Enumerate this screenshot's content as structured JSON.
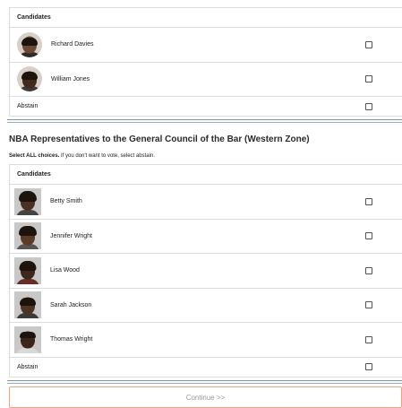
{
  "section1": {
    "header": "Candidates",
    "candidates": [
      {
        "name": "Richard Davies"
      },
      {
        "name": "William Jones"
      }
    ],
    "abstain_label": "Abstain"
  },
  "section2": {
    "title": "NBA Representatives to the General Council of the Bar (Western Zone)",
    "instruction_bold": "Select ALL choices.",
    "instruction_rest": " If you don't want to vote, select abstain.",
    "header": "Candidates",
    "candidates": [
      {
        "name": "Betty Smith"
      },
      {
        "name": "Jennifer Wright"
      },
      {
        "name": "Lisa Wood"
      },
      {
        "name": "Sarah Jackson"
      },
      {
        "name": "Thomas Wright"
      }
    ],
    "abstain_label": "Abstain"
  },
  "continue_label": "Continue >>",
  "colors": {
    "separator": "#7d95b5",
    "continue_border": "#f0a37a",
    "continue_text": "#9a9a9a"
  }
}
